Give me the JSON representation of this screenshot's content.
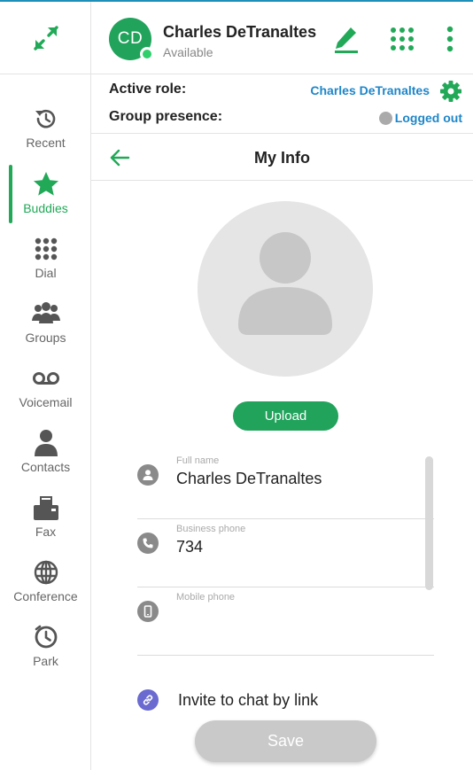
{
  "colors": {
    "accent": "#21a35c",
    "link": "#1e86c8",
    "topline": "#1e8fb8"
  },
  "header": {
    "avatar_initials": "CD",
    "user_name": "Charles DeTranaltes",
    "user_status": "Available"
  },
  "sidebar": {
    "items": [
      {
        "label": "Recent",
        "icon": "history-icon"
      },
      {
        "label": "Buddies",
        "icon": "star-icon",
        "active": true
      },
      {
        "label": "Dial",
        "icon": "dialpad-icon"
      },
      {
        "label": "Groups",
        "icon": "groups-icon"
      },
      {
        "label": "Voicemail",
        "icon": "voicemail-icon"
      },
      {
        "label": "Contacts",
        "icon": "contact-icon"
      },
      {
        "label": "Fax",
        "icon": "fax-icon"
      },
      {
        "label": "Conference",
        "icon": "globe-icon"
      },
      {
        "label": "Park",
        "icon": "clock-icon"
      }
    ]
  },
  "role": {
    "label": "Active role:",
    "value": "Charles DeTranaltes"
  },
  "presence": {
    "label": "Group presence:",
    "value": "Logged out"
  },
  "page": {
    "title": "My Info"
  },
  "profile": {
    "upload_label": "Upload",
    "fields": [
      {
        "label": "Full name",
        "value": "Charles DeTranaltes",
        "icon": "person-icon"
      },
      {
        "label": "Business phone",
        "value": "734",
        "icon": "phone-icon"
      },
      {
        "label": "Mobile phone",
        "value": "",
        "icon": "mobile-icon"
      }
    ],
    "invite_label": "Invite to chat by link",
    "save_label": "Save"
  }
}
